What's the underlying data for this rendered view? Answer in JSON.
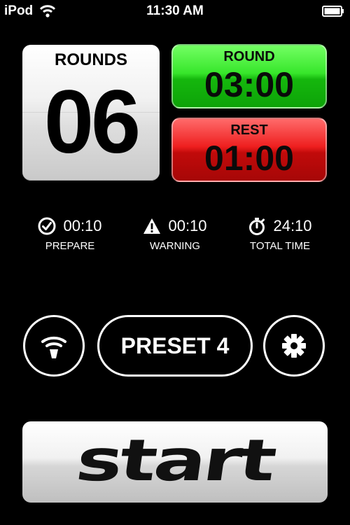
{
  "status_bar": {
    "carrier": "iPod",
    "time": "11:30 AM"
  },
  "rounds": {
    "label": "ROUNDS",
    "value": "06"
  },
  "round_timer": {
    "label": "ROUND",
    "value": "03:00",
    "color": "#2fd123"
  },
  "rest_timer": {
    "label": "REST",
    "value": "01:00",
    "color": "#e01414"
  },
  "stats": [
    {
      "icon": "checkmark-circle-icon",
      "value": "00:10",
      "label": "PREPARE"
    },
    {
      "icon": "warning-triangle-icon",
      "value": "00:10",
      "label": "WARNING"
    },
    {
      "icon": "stopwatch-icon",
      "value": "24:10",
      "label": "TOTAL TIME"
    }
  ],
  "controls": {
    "left_icon": "signal-cone-icon",
    "preset_label": "PRESET 4",
    "right_icon": "gear-icon"
  },
  "start_button": {
    "label": "start"
  }
}
